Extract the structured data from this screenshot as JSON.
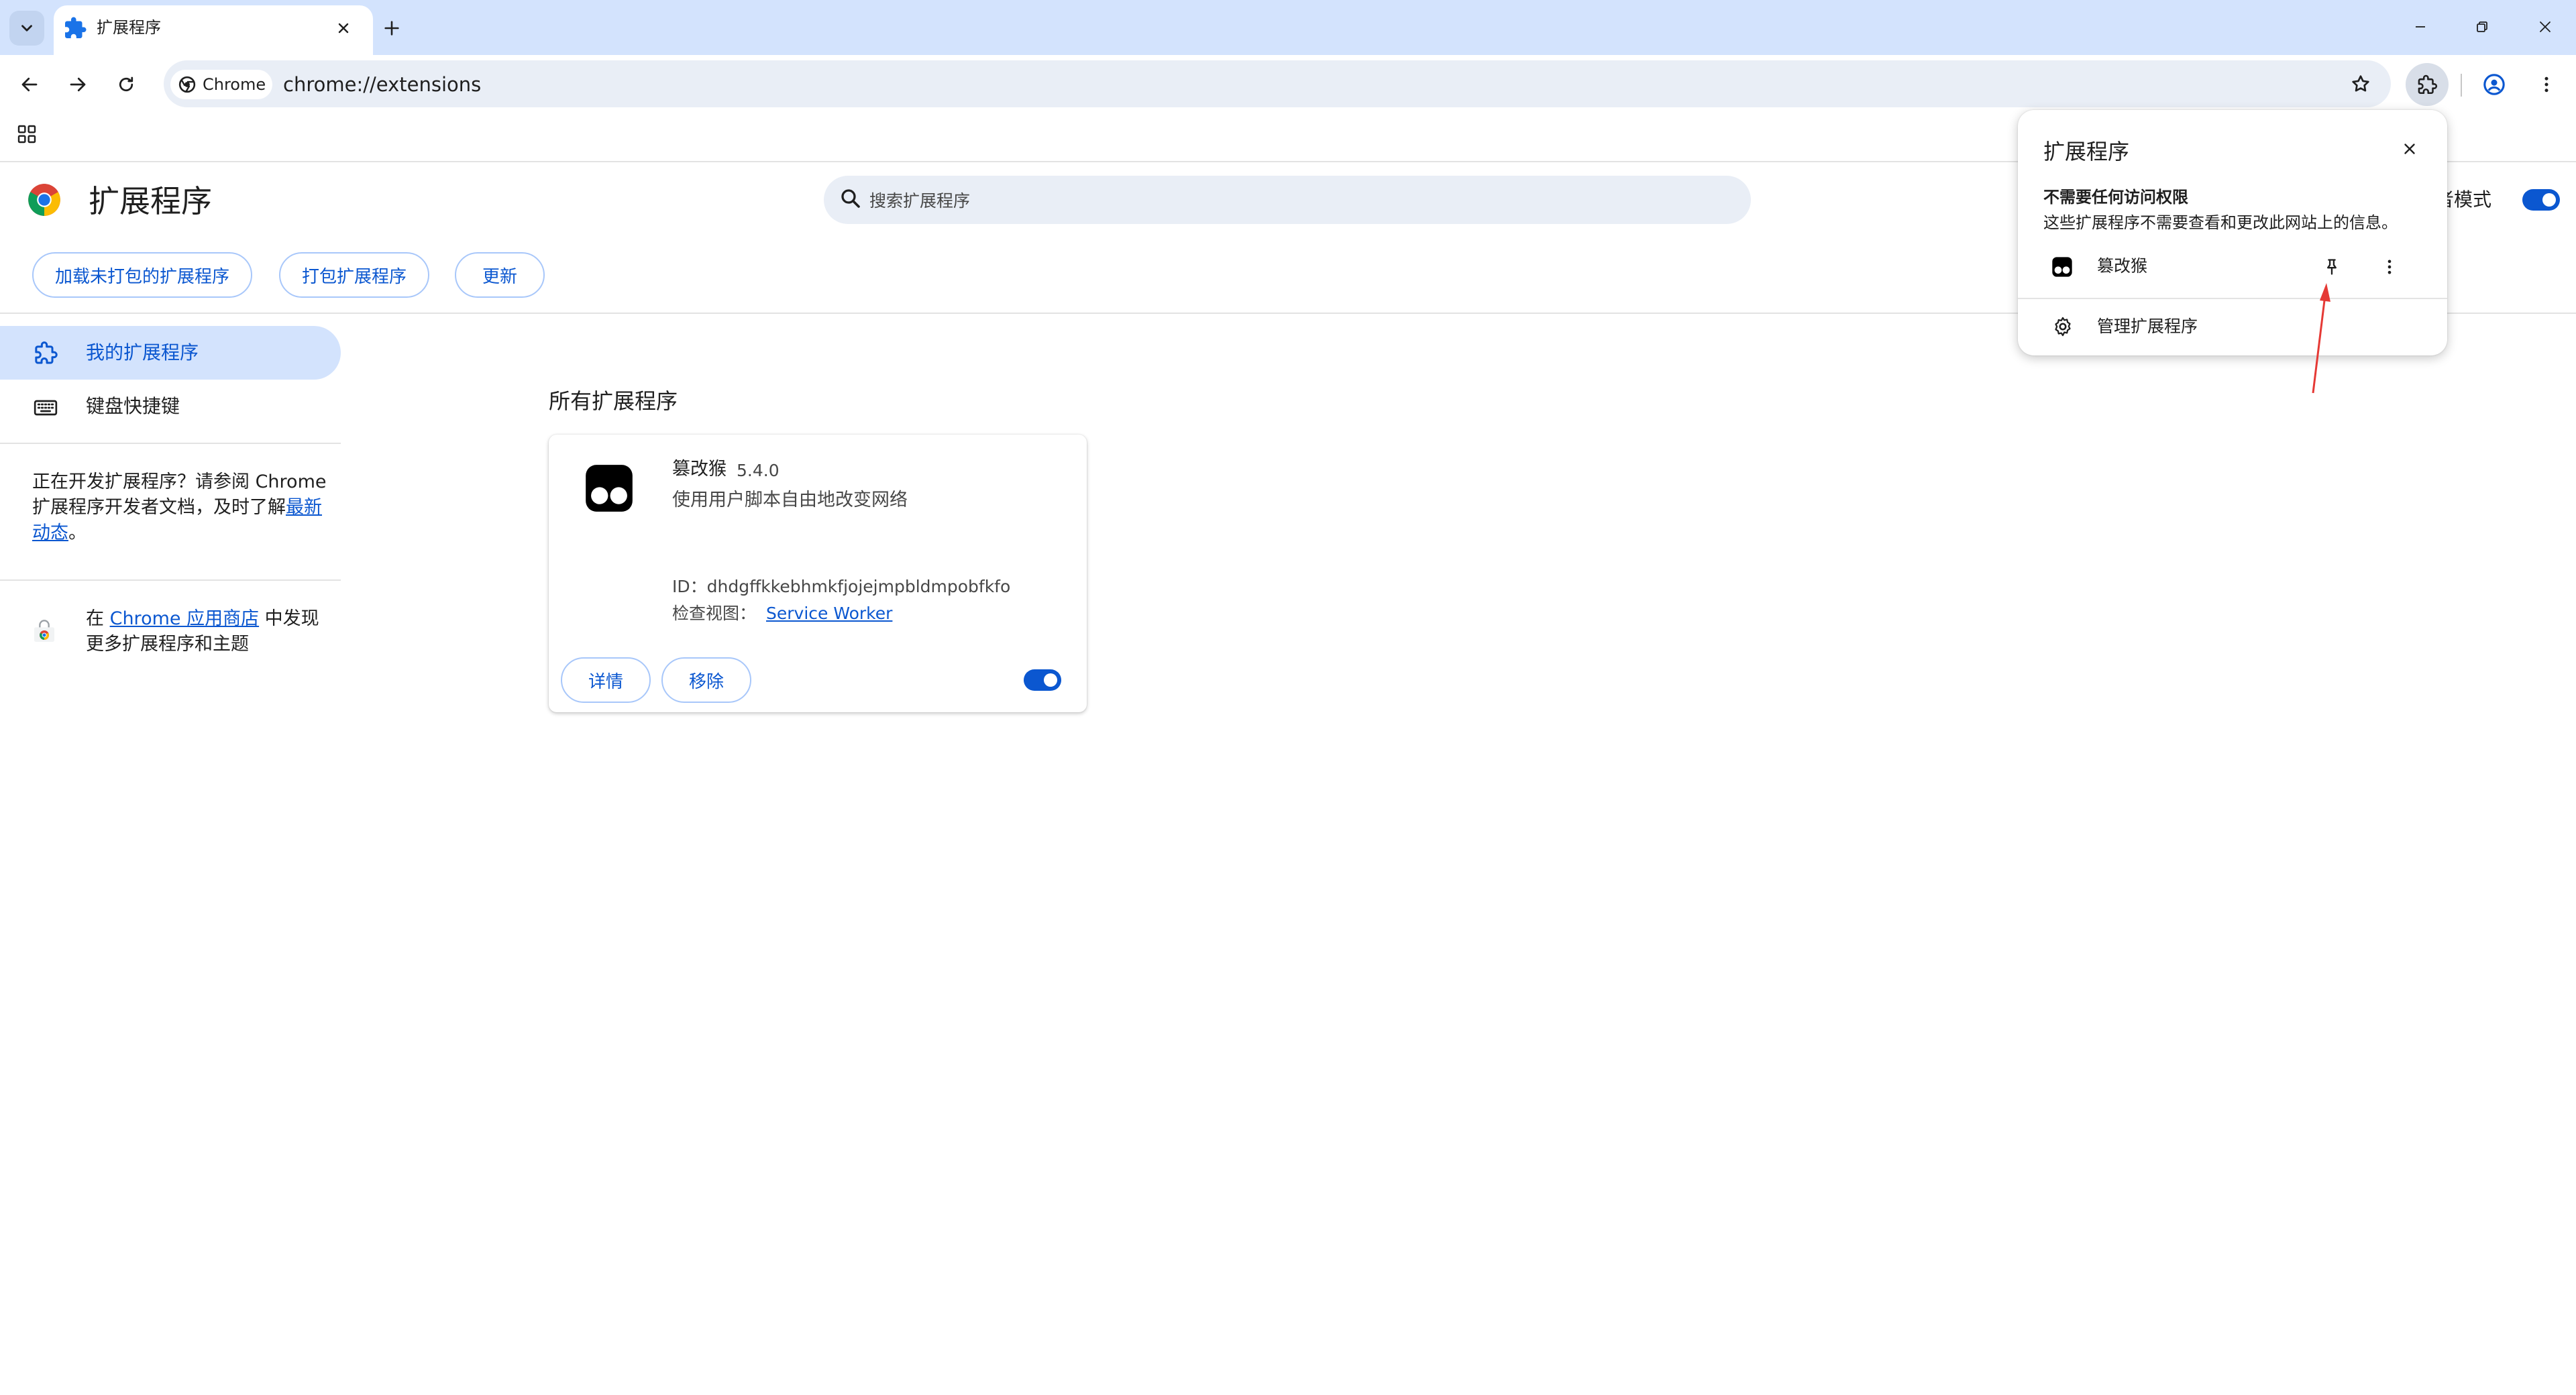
{
  "tab": {
    "title": "扩展程序"
  },
  "toolbar": {
    "site_chip": "Chrome",
    "url": "chrome://extensions"
  },
  "header": {
    "title": "扩展程序",
    "search_placeholder": "搜索扩展程序",
    "dev_mode_label": "者模式",
    "dev_mode_on": true
  },
  "actions": {
    "load_unpacked": "加载未打包的扩展程序",
    "pack": "打包扩展程序",
    "update": "更新"
  },
  "sidebar": {
    "items": [
      {
        "label": "我的扩展程序",
        "icon": "extension-icon",
        "active": true
      },
      {
        "label": "键盘快捷键",
        "icon": "keyboard-icon",
        "active": false
      }
    ],
    "dev_note": {
      "pre": "正在开发扩展程序？请参阅 Chrome 扩展程序开发者文档，及时了解",
      "link": "最新动态",
      "post": "。"
    },
    "store_note": {
      "pre": "在 ",
      "link": "Chrome 应用商店",
      "post": " 中发现更多扩展程序和主题"
    }
  },
  "main": {
    "section_title": "所有扩展程序",
    "extension": {
      "name": "篡改猴",
      "version": "5.4.0",
      "description": "使用用户脚本自由地改变网络",
      "id_label": "ID：dhdgffkkebhmkfjojejmpbldmpobfkfo",
      "views_label": "检查视图：",
      "views_link": "Service Worker",
      "details_btn": "详情",
      "remove_btn": "移除",
      "enabled": true
    }
  },
  "popup": {
    "title": "扩展程序",
    "section_heading": "不需要任何访问权限",
    "section_desc": "这些扩展程序不需要查看和更改此网站上的信息。",
    "ext_name": "篡改猴",
    "manage_label": "管理扩展程序"
  },
  "colors": {
    "accent": "#0b57d0",
    "tabstrip": "#d3e3fd",
    "annotation": "#e53935"
  }
}
